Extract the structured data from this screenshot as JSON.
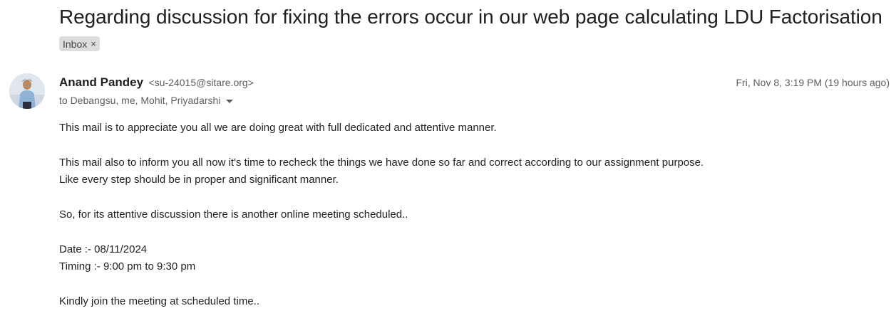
{
  "email": {
    "subject": "Regarding discussion for fixing the errors occur in our web page calculating LDU Factorisation",
    "label": "Inbox",
    "label_close": "×",
    "sender_name": "Anand Pandey",
    "sender_email": "<su-24015@sitare.org>",
    "date": "Fri, Nov 8, 3:19 PM (19 hours ago)",
    "recipients": "to Debangsu, me, Mohit, Priyadarshi",
    "body": {
      "p1": "This mail is to appreciate you all we are doing great with full dedicated and attentive manner.",
      "p2_line1": "This mail also to inform you all now it's time to recheck the things we have done so far and correct according to our assignment purpose.",
      "p2_line2": "Like every step should be in proper and significant manner.",
      "p3": "So, for its attentive discussion there is another online meeting scheduled..",
      "date_line": "Date :- 08/11/2024",
      "timing_line": "Timing :- 9:00 pm to 9:30 pm",
      "p5": "Kindly join the meeting at scheduled time.."
    }
  }
}
